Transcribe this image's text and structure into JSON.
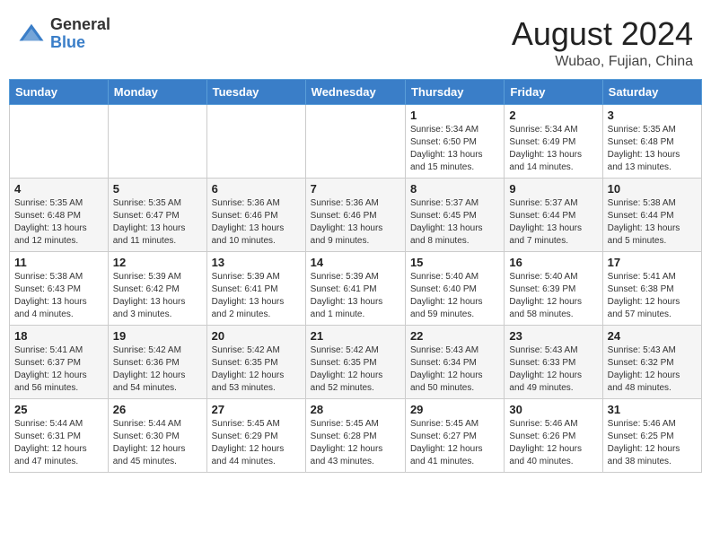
{
  "header": {
    "logo_general": "General",
    "logo_blue": "Blue",
    "month_year": "August 2024",
    "location": "Wubao, Fujian, China"
  },
  "weekdays": [
    "Sunday",
    "Monday",
    "Tuesday",
    "Wednesday",
    "Thursday",
    "Friday",
    "Saturday"
  ],
  "weeks": [
    [
      {
        "day": "",
        "info": ""
      },
      {
        "day": "",
        "info": ""
      },
      {
        "day": "",
        "info": ""
      },
      {
        "day": "",
        "info": ""
      },
      {
        "day": "1",
        "info": "Sunrise: 5:34 AM\nSunset: 6:50 PM\nDaylight: 13 hours\nand 15 minutes."
      },
      {
        "day": "2",
        "info": "Sunrise: 5:34 AM\nSunset: 6:49 PM\nDaylight: 13 hours\nand 14 minutes."
      },
      {
        "day": "3",
        "info": "Sunrise: 5:35 AM\nSunset: 6:48 PM\nDaylight: 13 hours\nand 13 minutes."
      }
    ],
    [
      {
        "day": "4",
        "info": "Sunrise: 5:35 AM\nSunset: 6:48 PM\nDaylight: 13 hours\nand 12 minutes."
      },
      {
        "day": "5",
        "info": "Sunrise: 5:35 AM\nSunset: 6:47 PM\nDaylight: 13 hours\nand 11 minutes."
      },
      {
        "day": "6",
        "info": "Sunrise: 5:36 AM\nSunset: 6:46 PM\nDaylight: 13 hours\nand 10 minutes."
      },
      {
        "day": "7",
        "info": "Sunrise: 5:36 AM\nSunset: 6:46 PM\nDaylight: 13 hours\nand 9 minutes."
      },
      {
        "day": "8",
        "info": "Sunrise: 5:37 AM\nSunset: 6:45 PM\nDaylight: 13 hours\nand 8 minutes."
      },
      {
        "day": "9",
        "info": "Sunrise: 5:37 AM\nSunset: 6:44 PM\nDaylight: 13 hours\nand 7 minutes."
      },
      {
        "day": "10",
        "info": "Sunrise: 5:38 AM\nSunset: 6:44 PM\nDaylight: 13 hours\nand 5 minutes."
      }
    ],
    [
      {
        "day": "11",
        "info": "Sunrise: 5:38 AM\nSunset: 6:43 PM\nDaylight: 13 hours\nand 4 minutes."
      },
      {
        "day": "12",
        "info": "Sunrise: 5:39 AM\nSunset: 6:42 PM\nDaylight: 13 hours\nand 3 minutes."
      },
      {
        "day": "13",
        "info": "Sunrise: 5:39 AM\nSunset: 6:41 PM\nDaylight: 13 hours\nand 2 minutes."
      },
      {
        "day": "14",
        "info": "Sunrise: 5:39 AM\nSunset: 6:41 PM\nDaylight: 13 hours\nand 1 minute."
      },
      {
        "day": "15",
        "info": "Sunrise: 5:40 AM\nSunset: 6:40 PM\nDaylight: 12 hours\nand 59 minutes."
      },
      {
        "day": "16",
        "info": "Sunrise: 5:40 AM\nSunset: 6:39 PM\nDaylight: 12 hours\nand 58 minutes."
      },
      {
        "day": "17",
        "info": "Sunrise: 5:41 AM\nSunset: 6:38 PM\nDaylight: 12 hours\nand 57 minutes."
      }
    ],
    [
      {
        "day": "18",
        "info": "Sunrise: 5:41 AM\nSunset: 6:37 PM\nDaylight: 12 hours\nand 56 minutes."
      },
      {
        "day": "19",
        "info": "Sunrise: 5:42 AM\nSunset: 6:36 PM\nDaylight: 12 hours\nand 54 minutes."
      },
      {
        "day": "20",
        "info": "Sunrise: 5:42 AM\nSunset: 6:35 PM\nDaylight: 12 hours\nand 53 minutes."
      },
      {
        "day": "21",
        "info": "Sunrise: 5:42 AM\nSunset: 6:35 PM\nDaylight: 12 hours\nand 52 minutes."
      },
      {
        "day": "22",
        "info": "Sunrise: 5:43 AM\nSunset: 6:34 PM\nDaylight: 12 hours\nand 50 minutes."
      },
      {
        "day": "23",
        "info": "Sunrise: 5:43 AM\nSunset: 6:33 PM\nDaylight: 12 hours\nand 49 minutes."
      },
      {
        "day": "24",
        "info": "Sunrise: 5:43 AM\nSunset: 6:32 PM\nDaylight: 12 hours\nand 48 minutes."
      }
    ],
    [
      {
        "day": "25",
        "info": "Sunrise: 5:44 AM\nSunset: 6:31 PM\nDaylight: 12 hours\nand 47 minutes."
      },
      {
        "day": "26",
        "info": "Sunrise: 5:44 AM\nSunset: 6:30 PM\nDaylight: 12 hours\nand 45 minutes."
      },
      {
        "day": "27",
        "info": "Sunrise: 5:45 AM\nSunset: 6:29 PM\nDaylight: 12 hours\nand 44 minutes."
      },
      {
        "day": "28",
        "info": "Sunrise: 5:45 AM\nSunset: 6:28 PM\nDaylight: 12 hours\nand 43 minutes."
      },
      {
        "day": "29",
        "info": "Sunrise: 5:45 AM\nSunset: 6:27 PM\nDaylight: 12 hours\nand 41 minutes."
      },
      {
        "day": "30",
        "info": "Sunrise: 5:46 AM\nSunset: 6:26 PM\nDaylight: 12 hours\nand 40 minutes."
      },
      {
        "day": "31",
        "info": "Sunrise: 5:46 AM\nSunset: 6:25 PM\nDaylight: 12 hours\nand 38 minutes."
      }
    ]
  ]
}
